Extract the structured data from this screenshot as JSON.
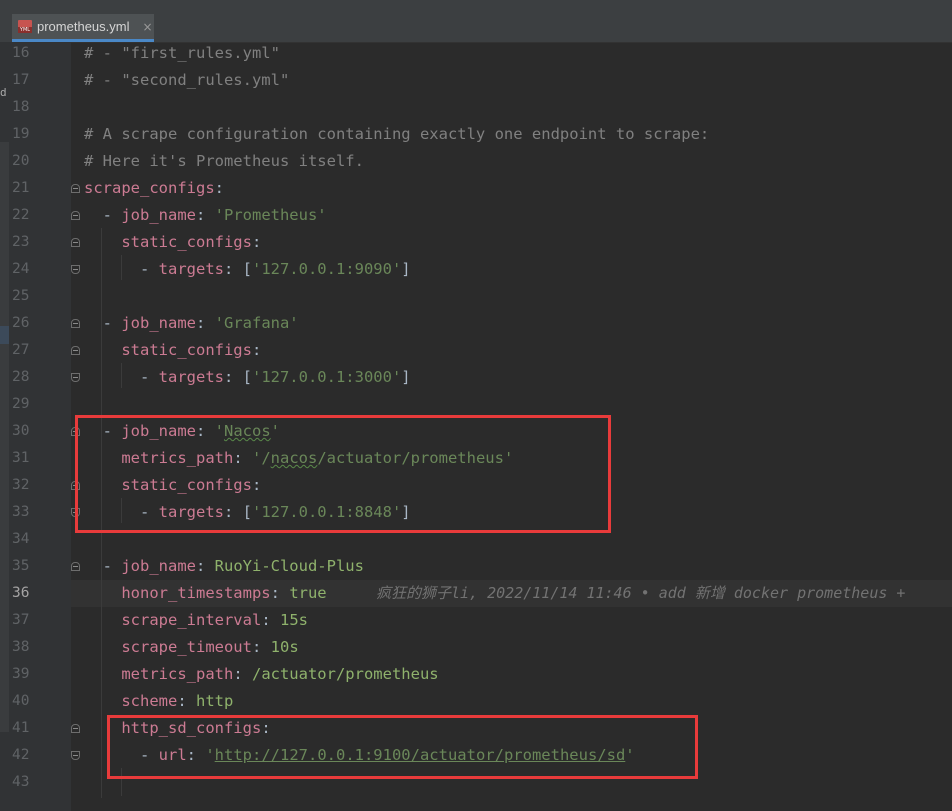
{
  "tab": {
    "icon": "yml-file-icon",
    "filename": "prometheus.yml",
    "close": "×"
  },
  "left_strip": {
    "letter": "d"
  },
  "current_line": 36,
  "lines": [
    {
      "n": "16",
      "parts": [
        [
          "comment",
          "# - \"first_rules.yml\""
        ]
      ]
    },
    {
      "n": "17",
      "parts": [
        [
          "comment",
          "# - \"second_rules.yml\""
        ]
      ]
    },
    {
      "n": "18",
      "parts": []
    },
    {
      "n": "19",
      "parts": [
        [
          "comment",
          "# A scrape configuration containing exactly one endpoint to scrape:"
        ]
      ]
    },
    {
      "n": "20",
      "parts": [
        [
          "comment",
          "# Here it's Prometheus itself."
        ]
      ]
    },
    {
      "n": "21",
      "parts": [
        [
          "key",
          "scrape_configs"
        ],
        [
          "punct",
          ":"
        ]
      ]
    },
    {
      "n": "22",
      "parts": [
        [
          "punct",
          "  - "
        ],
        [
          "key",
          "job_name"
        ],
        [
          "punct",
          ": "
        ],
        [
          "str",
          "'Prometheus'"
        ]
      ]
    },
    {
      "n": "23",
      "parts": [
        [
          "punct",
          "    "
        ],
        [
          "key",
          "static_configs"
        ],
        [
          "punct",
          ":"
        ]
      ]
    },
    {
      "n": "24",
      "parts": [
        [
          "punct",
          "      - "
        ],
        [
          "key",
          "targets"
        ],
        [
          "punct",
          ": ["
        ],
        [
          "str",
          "'127.0.0.1:9090'"
        ],
        [
          "punct",
          "]"
        ]
      ]
    },
    {
      "n": "25",
      "parts": []
    },
    {
      "n": "26",
      "parts": [
        [
          "punct",
          "  - "
        ],
        [
          "key",
          "job_name"
        ],
        [
          "punct",
          ": "
        ],
        [
          "str",
          "'Grafana'"
        ]
      ]
    },
    {
      "n": "27",
      "parts": [
        [
          "punct",
          "    "
        ],
        [
          "key",
          "static_configs"
        ],
        [
          "punct",
          ":"
        ]
      ]
    },
    {
      "n": "28",
      "parts": [
        [
          "punct",
          "      - "
        ],
        [
          "key",
          "targets"
        ],
        [
          "punct",
          ": ["
        ],
        [
          "str",
          "'127.0.0.1:3000'"
        ],
        [
          "punct",
          "]"
        ]
      ]
    },
    {
      "n": "29",
      "parts": []
    },
    {
      "n": "30",
      "parts": [
        [
          "punct",
          "  - "
        ],
        [
          "key",
          "job_name"
        ],
        [
          "punct",
          ": "
        ],
        [
          "str",
          "'"
        ],
        [
          "strsq",
          "Nacos"
        ],
        [
          "str",
          "'"
        ]
      ]
    },
    {
      "n": "31",
      "parts": [
        [
          "punct",
          "    "
        ],
        [
          "key",
          "metrics_path"
        ],
        [
          "punct",
          ": "
        ],
        [
          "str",
          "'/"
        ],
        [
          "strsq",
          "nacos"
        ],
        [
          "str",
          "/actuator/prometheus'"
        ]
      ]
    },
    {
      "n": "32",
      "parts": [
        [
          "punct",
          "    "
        ],
        [
          "key",
          "static_configs"
        ],
        [
          "punct",
          ":"
        ]
      ]
    },
    {
      "n": "33",
      "parts": [
        [
          "punct",
          "      - "
        ],
        [
          "key",
          "targets"
        ],
        [
          "punct",
          ": ["
        ],
        [
          "str",
          "'127.0.0.1:8848'"
        ],
        [
          "punct",
          "]"
        ]
      ]
    },
    {
      "n": "34",
      "parts": []
    },
    {
      "n": "35",
      "parts": [
        [
          "punct",
          "  - "
        ],
        [
          "key",
          "job_name"
        ],
        [
          "punct",
          ": "
        ],
        [
          "green",
          "RuoYi-Cloud-Plus"
        ]
      ]
    },
    {
      "n": "36",
      "parts": [
        [
          "punct",
          "    "
        ],
        [
          "key",
          "honor_timestamps"
        ],
        [
          "punct",
          ": "
        ],
        [
          "green",
          "true"
        ]
      ],
      "blame": "疯狂的狮子li, 2022/11/14 11:46 • add 新增 docker prometheus +"
    },
    {
      "n": "37",
      "parts": [
        [
          "punct",
          "    "
        ],
        [
          "key",
          "scrape_interval"
        ],
        [
          "punct",
          ": "
        ],
        [
          "green",
          "15s"
        ]
      ]
    },
    {
      "n": "38",
      "parts": [
        [
          "punct",
          "    "
        ],
        [
          "key",
          "scrape_timeout"
        ],
        [
          "punct",
          ": "
        ],
        [
          "green",
          "10s"
        ]
      ]
    },
    {
      "n": "39",
      "parts": [
        [
          "punct",
          "    "
        ],
        [
          "key",
          "metrics_path"
        ],
        [
          "punct",
          ": "
        ],
        [
          "green",
          "/actuator/prometheus"
        ]
      ]
    },
    {
      "n": "40",
      "parts": [
        [
          "punct",
          "    "
        ],
        [
          "key",
          "scheme"
        ],
        [
          "punct",
          ": "
        ],
        [
          "green",
          "http"
        ]
      ]
    },
    {
      "n": "41",
      "parts": [
        [
          "punct",
          "    "
        ],
        [
          "key",
          "http_sd_configs"
        ],
        [
          "punct",
          ":"
        ]
      ]
    },
    {
      "n": "42",
      "parts": [
        [
          "punct",
          "      - "
        ],
        [
          "key",
          "url"
        ],
        [
          "punct",
          ": "
        ],
        [
          "str",
          "'"
        ],
        [
          "url",
          "http://127.0.0.1:9100/actuator/prometheus/sd"
        ],
        [
          "str",
          "'"
        ]
      ]
    },
    {
      "n": "43",
      "parts": []
    }
  ],
  "highlight_boxes": [
    "nacos-job",
    "http-sd-configs"
  ],
  "colors": {
    "background": "#2b2b2b",
    "gutter": "#313335",
    "key": "#cc7b93",
    "string": "#6a8759",
    "comment": "#808080",
    "highlight_box": "#e83b3b"
  }
}
